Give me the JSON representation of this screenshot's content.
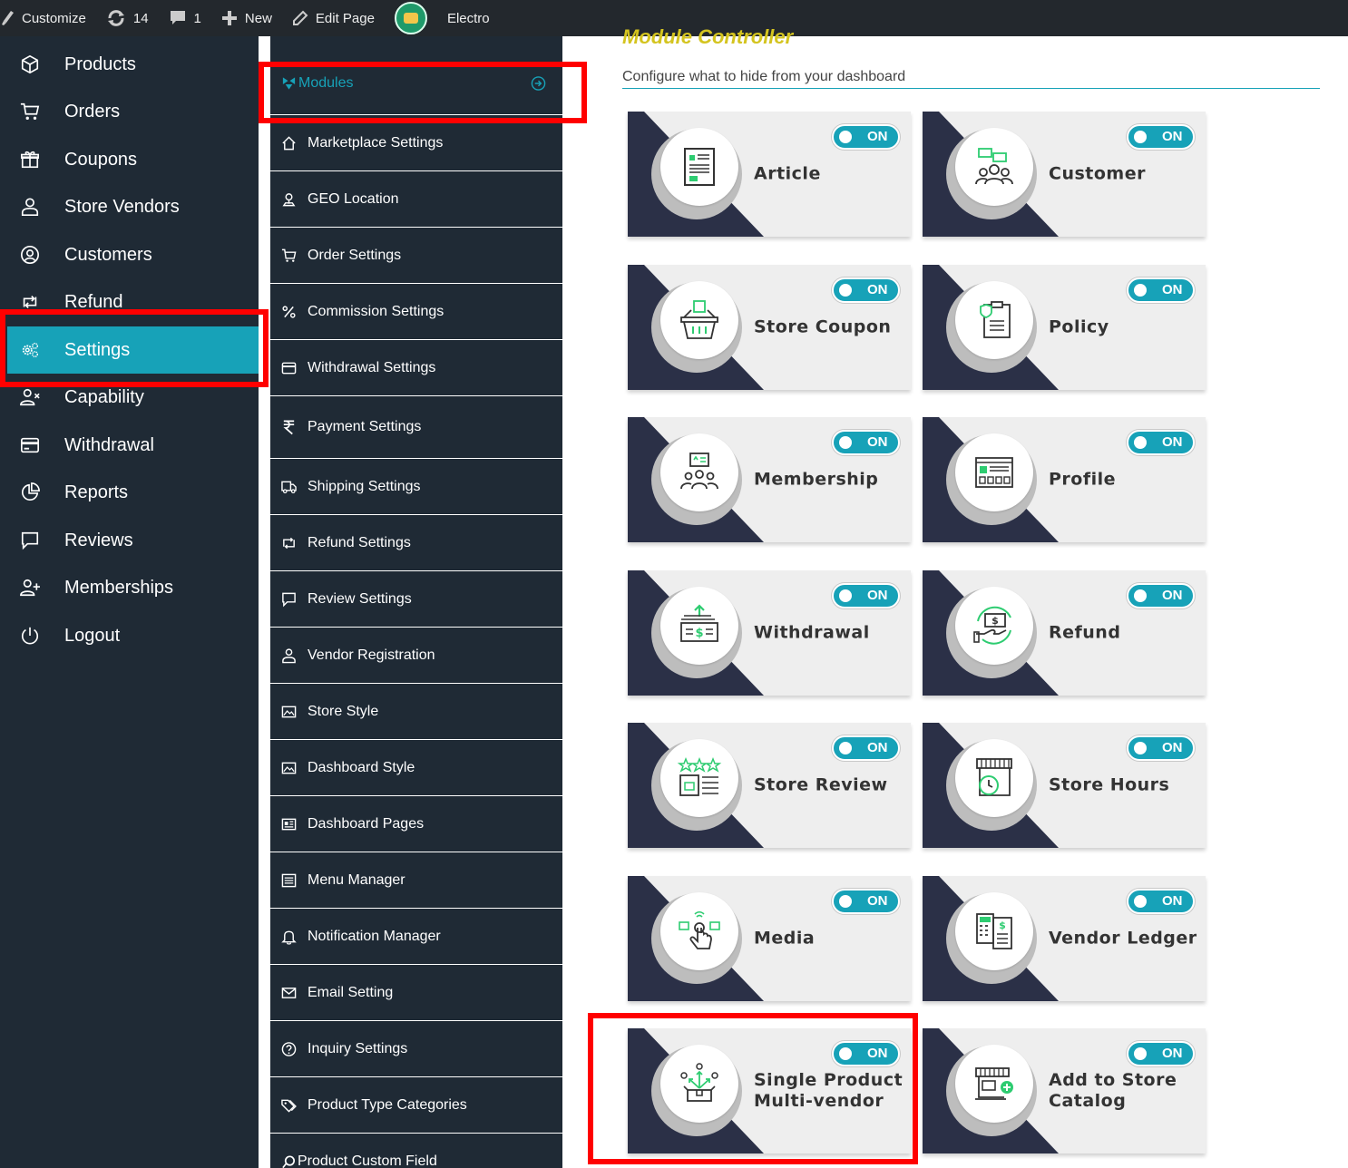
{
  "adminbar": {
    "customize": "Customize",
    "updates_count": "14",
    "comments_count": "1",
    "new_label": "New",
    "edit_page": "Edit Page",
    "site_name": "Electro"
  },
  "sidebar": {
    "items": [
      {
        "label": "Products",
        "icon": "box-icon"
      },
      {
        "label": "Orders",
        "icon": "cart-icon"
      },
      {
        "label": "Coupons",
        "icon": "gift-icon"
      },
      {
        "label": "Store Vendors",
        "icon": "user-icon"
      },
      {
        "label": "Customers",
        "icon": "user-circle-icon"
      },
      {
        "label": "Refund",
        "icon": "retweet-icon"
      },
      {
        "label": "Settings",
        "icon": "cogs-icon",
        "active": true
      },
      {
        "label": "Capability",
        "icon": "user-x-icon"
      },
      {
        "label": "Withdrawal",
        "icon": "credit-card-icon"
      },
      {
        "label": "Reports",
        "icon": "pie-chart-icon"
      },
      {
        "label": "Reviews",
        "icon": "comment-icon"
      },
      {
        "label": "Memberships",
        "icon": "user-plus-icon"
      },
      {
        "label": "Logout",
        "icon": "power-icon"
      }
    ]
  },
  "settings_nav": {
    "items": [
      {
        "label": "Modules",
        "selected": true
      },
      {
        "label": "Marketplace Settings"
      },
      {
        "label": "GEO Location"
      },
      {
        "label": "Order Settings"
      },
      {
        "label": "Commission Settings"
      },
      {
        "label": "Withdrawal Settings"
      },
      {
        "label": "Payment Settings"
      },
      {
        "label": "Shipping Settings"
      },
      {
        "label": "Refund Settings"
      },
      {
        "label": "Review Settings"
      },
      {
        "label": "Vendor Registration"
      },
      {
        "label": "Store Style"
      },
      {
        "label": "Dashboard Style"
      },
      {
        "label": "Dashboard Pages"
      },
      {
        "label": "Menu Manager"
      },
      {
        "label": "Notification Manager"
      },
      {
        "label": "Email Setting"
      },
      {
        "label": "Inquiry Settings"
      },
      {
        "label": "Product Type Categories"
      },
      {
        "label": "Product Custom Field"
      }
    ]
  },
  "main": {
    "title": "Module Controller",
    "subtitle": "Configure what to hide from your dashboard",
    "toggle_label": "ON",
    "modules": [
      {
        "name": "Article",
        "state": "ON"
      },
      {
        "name": "Customer",
        "state": "ON"
      },
      {
        "name": "Store Coupon",
        "state": "ON"
      },
      {
        "name": "Policy",
        "state": "ON"
      },
      {
        "name": "Membership",
        "state": "ON"
      },
      {
        "name": "Profile",
        "state": "ON"
      },
      {
        "name": "Withdrawal",
        "state": "ON"
      },
      {
        "name": "Refund",
        "state": "ON"
      },
      {
        "name": "Store Review",
        "state": "ON"
      },
      {
        "name": "Store Hours",
        "state": "ON"
      },
      {
        "name": "Media",
        "state": "ON"
      },
      {
        "name": "Vendor Ledger",
        "state": "ON"
      },
      {
        "name": "Single Product Multi-vendor",
        "line1": "Single Product",
        "line2": "Multi-vendor",
        "state": "ON"
      },
      {
        "name": "Add to Store Catalog",
        "line1": "Add to Store",
        "line2": "Catalog",
        "state": "ON"
      }
    ]
  },
  "colors": {
    "accent": "#17a2b8",
    "sidebar_bg": "#1f2a35",
    "adminbar_bg": "#23282d",
    "card_dark": "#2b3047",
    "highlight": "#ff0000",
    "title": "#d4c41f"
  }
}
